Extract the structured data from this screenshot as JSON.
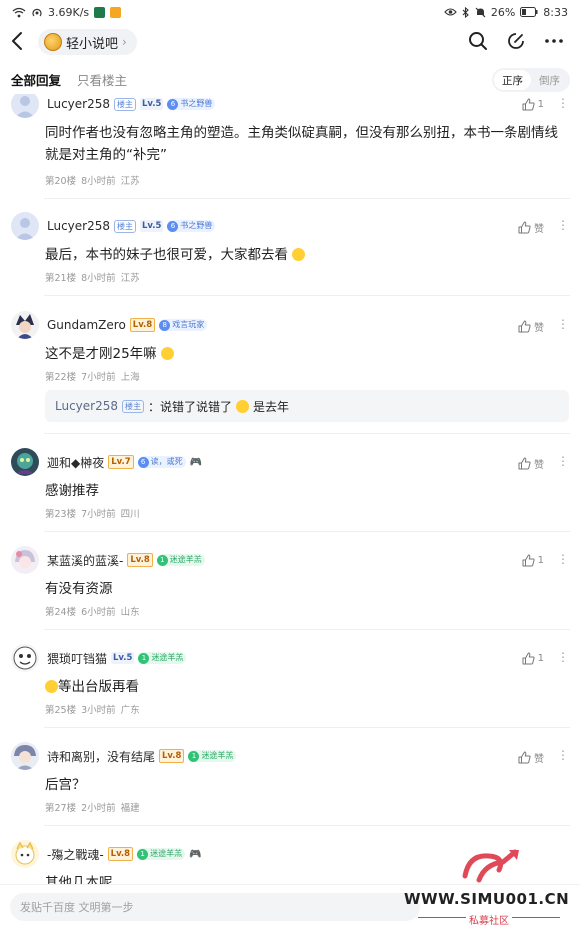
{
  "status_bar": {
    "speed": "3.69K/s",
    "battery": "26%",
    "time": "8:33"
  },
  "header": {
    "forum_name": "轻小说吧",
    "forum_arrow": "›"
  },
  "tabs": {
    "all": "全部回复",
    "op_only": "只看楼主"
  },
  "sort": {
    "asc": "正序",
    "desc": "倒序",
    "active": "正序"
  },
  "posts": [
    {
      "user": "Lucyer258",
      "op_badge": "楼主",
      "level": "Lv.5",
      "title_num": "6",
      "title": "书之野兽",
      "content": "同时作者也没有忽略主角的塑造。主角类似碇真嗣，但没有那么别扭，本书一条剧情线就是对主角的“补完”",
      "floor": "第20楼",
      "time": "8小时前",
      "location": "江苏",
      "likes": "1"
    },
    {
      "user": "Lucyer258",
      "op_badge": "楼主",
      "level": "Lv.5",
      "title_num": "6",
      "title": "书之野兽",
      "content": "最后，本书的妹子也很可爱，大家都去看",
      "floor": "第21楼",
      "time": "8小时前",
      "location": "江苏",
      "likes": "赞"
    },
    {
      "user": "GundamZero",
      "level": "Lv.8",
      "title_num": "8",
      "title": "戏言玩家",
      "content": "这不是才刚25年嘛",
      "floor": "第22楼",
      "time": "7小时前",
      "location": "上海",
      "likes": "赞",
      "reply": {
        "user": "Lucyer258",
        "op_badge": "楼主",
        "text_before": "：说错了说错了",
        "text_after": "是去年"
      }
    },
    {
      "user": "迦和◆榊夜",
      "level": "Lv.7",
      "title_num": "6",
      "title": "读，或死",
      "content": "感谢推荐",
      "floor": "第23楼",
      "time": "7小时前",
      "location": "四川",
      "likes": "赞"
    },
    {
      "user": "某蓝溪的蓝溪-",
      "level": "Lv.8",
      "title_num": "1",
      "title": "迷途羊羔",
      "content": "有没有资源",
      "floor": "第24楼",
      "time": "6小时前",
      "location": "山东",
      "likes": "1"
    },
    {
      "user": "猥琐叮铛猫",
      "level": "Lv.5",
      "title_num": "1",
      "title": "迷途羊羔",
      "content": "等出台版再看",
      "floor": "第25楼",
      "time": "3小时前",
      "location": "广东",
      "likes": "1"
    },
    {
      "user": "诗和离别，没有结尾",
      "level": "Lv.8",
      "title_num": "1",
      "title": "迷途羊羔",
      "content": "后宫？",
      "floor": "第27楼",
      "time": "2小时前",
      "location": "福建",
      "likes": "赞"
    },
    {
      "user": "-殤之戰魂-",
      "level": "Lv.8",
      "title_num": "1",
      "title": "迷途羊羔",
      "content": "其他几本呢"
    }
  ],
  "bottom": {
    "placeholder": "发贴千百度 文明第一步"
  },
  "watermark": {
    "site": "WWW.SIMU001.CN",
    "sub": "私募社区"
  },
  "colors": {
    "op_badge": "#5b86d6",
    "level_blue": "#3b5ba5",
    "level_orange": "#b45f00",
    "title_blue": "#4d79d0",
    "title_green": "#2aa765",
    "watermark_red": "#d93e4c"
  }
}
